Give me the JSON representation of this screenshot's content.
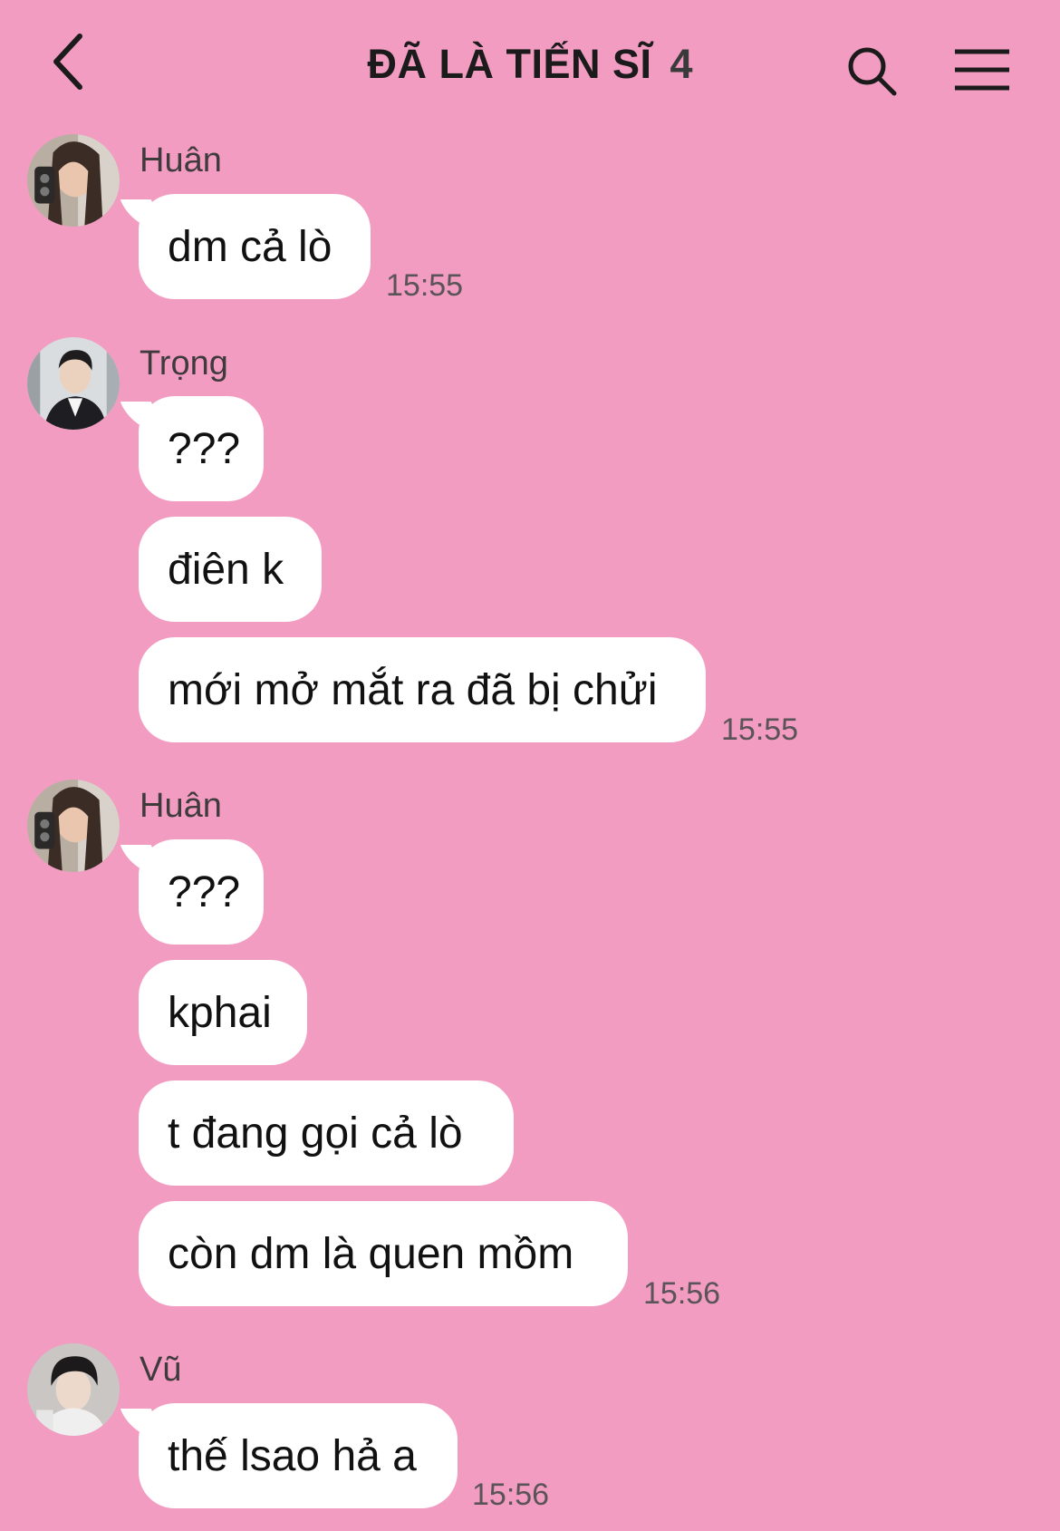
{
  "header": {
    "title": "ĐÃ LÀ TIẾN SĨ",
    "member_count": "4",
    "back_icon": "chevron-left-icon",
    "search_icon": "search-icon",
    "menu_icon": "hamburger-menu-icon"
  },
  "messages": [
    {
      "sender": "Huân",
      "bubbles": [
        "dm cả lò"
      ],
      "time": "15:55"
    },
    {
      "sender": "Trọng",
      "bubbles": [
        "???",
        "điên k",
        "mới mở mắt ra đã bị chửi"
      ],
      "time": "15:55"
    },
    {
      "sender": "Huân",
      "bubbles": [
        "???",
        "kphai",
        "t đang gọi cả lò",
        "còn dm là quen mồm"
      ],
      "time": "15:56"
    },
    {
      "sender": "Vũ",
      "bubbles": [
        "thế lsao hả a"
      ],
      "time": "15:56"
    }
  ],
  "colors": {
    "background": "#F39CC2",
    "bubble": "#FFFFFF",
    "text": "#111111",
    "meta_text": "#5A5458"
  }
}
